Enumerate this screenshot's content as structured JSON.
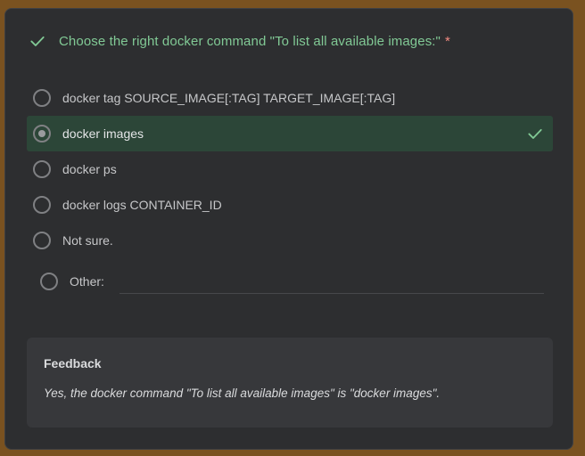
{
  "question": {
    "title": "Choose the right docker command \"To list all available images:\"",
    "required_marker": "*",
    "status_icon": "check-icon",
    "status_color": "#81c995"
  },
  "options": [
    {
      "label": "docker tag SOURCE_IMAGE[:TAG] TARGET_IMAGE[:TAG]",
      "selected": false
    },
    {
      "label": "docker images",
      "selected": true,
      "correct": true
    },
    {
      "label": "docker ps",
      "selected": false
    },
    {
      "label": "docker logs CONTAINER_ID",
      "selected": false
    },
    {
      "label": "Not sure.",
      "selected": false
    }
  ],
  "other_option": {
    "label": "Other:",
    "value": ""
  },
  "feedback": {
    "title": "Feedback",
    "text": "Yes, the docker command \"To list all available images\" is \"docker images\"."
  }
}
